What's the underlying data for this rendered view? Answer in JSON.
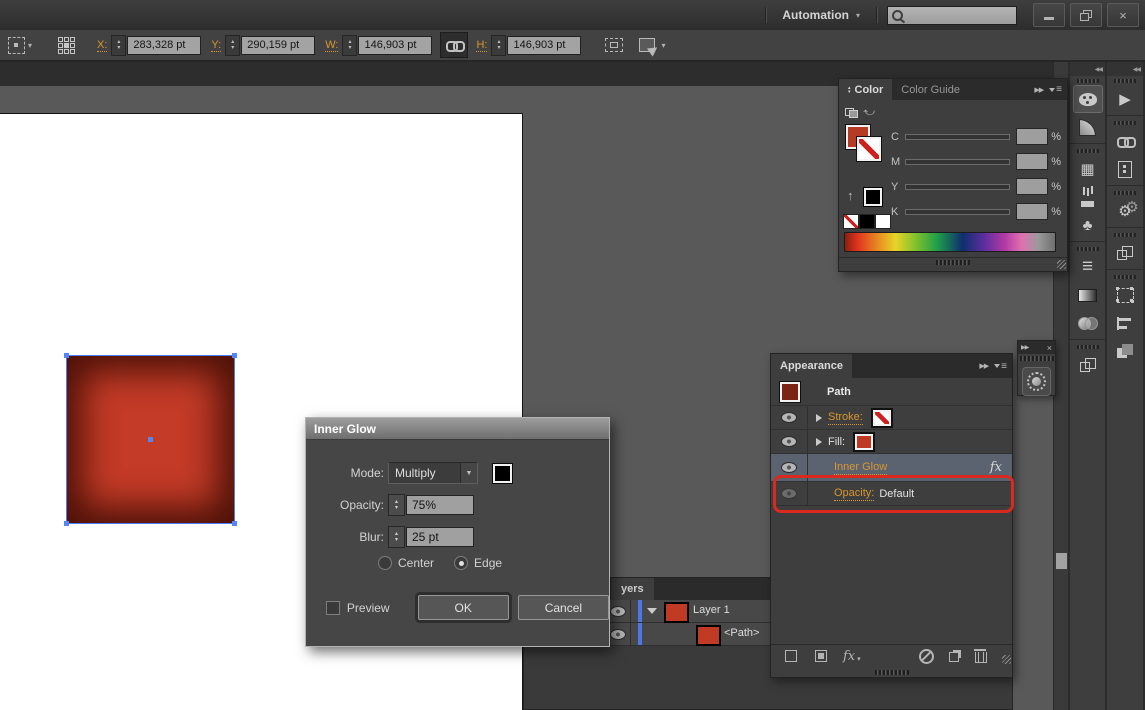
{
  "titlebar": {
    "menu_label": "Automation",
    "search_value": ""
  },
  "control_bar": {
    "fields": [
      {
        "label": "X:",
        "value": "283,328 pt"
      },
      {
        "label": "Y:",
        "value": "290,159 pt"
      },
      {
        "label": "W:",
        "value": "146,903 pt"
      },
      {
        "label": "H:",
        "value": "146,903 pt"
      }
    ]
  },
  "color_panel": {
    "tabs": [
      {
        "label": "Color"
      },
      {
        "label": "Color Guide"
      }
    ],
    "sliders": [
      {
        "label": "C"
      },
      {
        "label": "M"
      },
      {
        "label": "Y"
      },
      {
        "label": "K"
      }
    ],
    "percent": "%"
  },
  "appearance_panel": {
    "tab": "Appearance",
    "item_title": "Path",
    "rows": [
      {
        "label": "Stroke:"
      },
      {
        "label": "Fill:"
      },
      {
        "label": "Inner Glow",
        "fx": "fx"
      },
      {
        "label": "Opacity:",
        "value": "Default"
      }
    ],
    "fx_button": "fx"
  },
  "layers_panel": {
    "tab": "yers",
    "rows": [
      {
        "name": "Layer 1"
      },
      {
        "name": "<Path>"
      }
    ]
  },
  "dialog": {
    "title": "Inner Glow",
    "mode_label": "Mode:",
    "mode_value": "Multiply",
    "opacity_label": "Opacity:",
    "opacity_value": "75%",
    "blur_label": "Blur:",
    "blur_value": "25 pt",
    "center_label": "Center",
    "edge_label": "Edge",
    "preview_label": "Preview",
    "ok_label": "OK",
    "cancel_label": "Cancel"
  },
  "glyphs": {
    "up": "▴",
    "down": "▾",
    "dropdown": "▼",
    "collapse": "◀◀",
    "expand": "▶▶",
    "close": "×",
    "swatches": "▦",
    "club": "♣",
    "lines": "≡",
    "play": "▶",
    "gear": "⚙",
    "up_arrow": "↑"
  },
  "dock_icons": {
    "left_column": [
      "color",
      "color-guide",
      "swatches",
      "brushes",
      "symbols",
      "stroke",
      "gradient",
      "transparency",
      "artboards"
    ],
    "right_column": [
      "actions",
      "links",
      "artboard-info",
      "automation",
      "pathfinder-panel",
      "free-transform",
      "align",
      "pathfinder"
    ]
  },
  "colors": {
    "accent_orange": "#d8962e",
    "selection_blue": "#4d7cf7",
    "annotation_red": "#da291d",
    "artwork_red": "#c43b27",
    "artwork_glow": "#380a02",
    "pasteboard": "#595959",
    "panel_bg": "#3e3e3e"
  }
}
